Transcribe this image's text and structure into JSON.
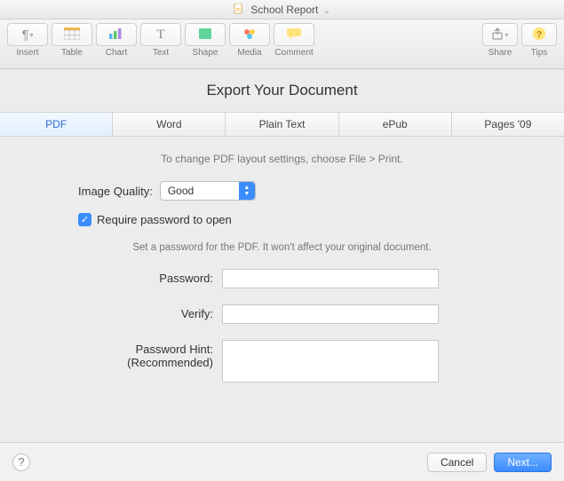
{
  "window": {
    "title": "School Report"
  },
  "toolbar": {
    "items": [
      {
        "label": "Insert"
      },
      {
        "label": "Table"
      },
      {
        "label": "Chart"
      },
      {
        "label": "Text"
      },
      {
        "label": "Shape"
      },
      {
        "label": "Media"
      },
      {
        "label": "Comment"
      }
    ],
    "rightItems": [
      {
        "label": "Share"
      },
      {
        "label": "Tips"
      }
    ]
  },
  "heading": "Export Your Document",
  "tabs": [
    "PDF",
    "Word",
    "Plain Text",
    "ePub",
    "Pages '09"
  ],
  "activeTab": "PDF",
  "hint": "To change PDF layout settings, choose File > Print.",
  "quality": {
    "label": "Image Quality:",
    "value": "Good"
  },
  "requirePassword": {
    "checked": true,
    "label": "Require password to open"
  },
  "subhint": "Set a password for the PDF. It won't affect your original document.",
  "fields": {
    "password": {
      "label": "Password:",
      "value": ""
    },
    "verify": {
      "label": "Verify:",
      "value": ""
    },
    "hint": {
      "labelLine1": "Password Hint:",
      "labelLine2": "(Recommended)",
      "value": ""
    }
  },
  "footer": {
    "cancel": "Cancel",
    "next": "Next..."
  }
}
